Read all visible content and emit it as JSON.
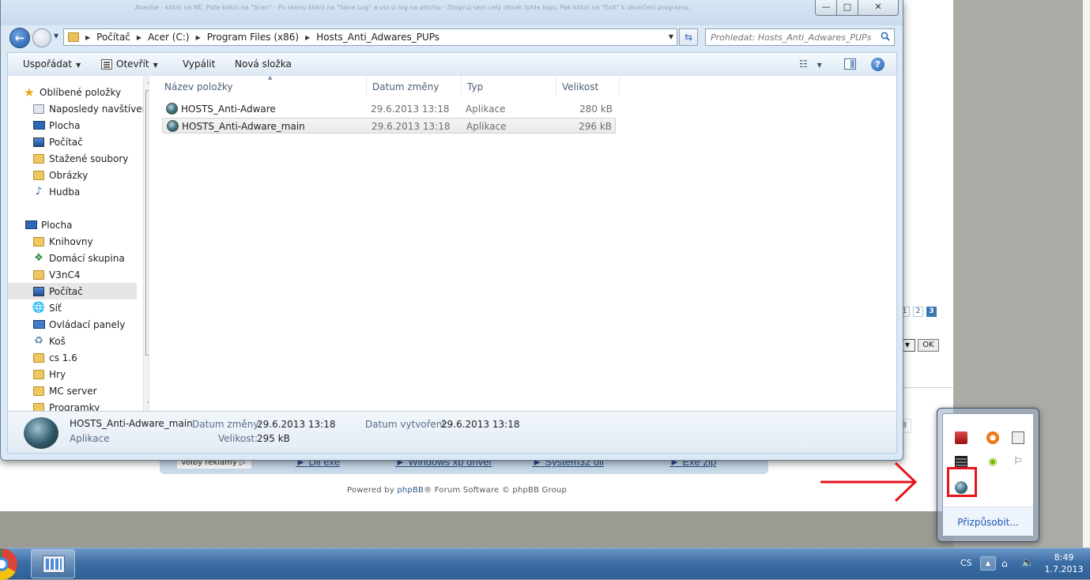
{
  "background_page": {
    "blurred_text": "Anastie - klikni na NE, Pote klikni na \"Scan\" - Po skenu klikni na \"Save Log\" a ulo si log na plochu - Zkopruj sem celý obsah tohle logu. Pak klikni na \"Exit\" k ukončení programu.",
    "pagination": [
      "1",
      "2",
      "3"
    ],
    "ok_button": "OK",
    "ad_label": "Volby reklamy",
    "ad_links": [
      "► Dll exe",
      "► Windows xp driver",
      "► System32 dll",
      "► Exe zip"
    ],
    "powered_by": {
      "prefix": "Powered by ",
      "brand": "phpBB",
      "suffix": "® Forum Software © phpBB Group"
    },
    "box_char": "3"
  },
  "window": {
    "buttons": {
      "minimize": "—",
      "maximize": "□",
      "close": "✕"
    },
    "breadcrumbs": [
      "Počítač",
      "Acer (C:)",
      "Program Files (x86)",
      "Hosts_Anti_Adwares_PUPs"
    ],
    "search_placeholder": "Prohledat: Hosts_Anti_Adwares_PUPs",
    "toolbar": {
      "organize": "Uspořádat",
      "open": "Otevřít",
      "burn": "Vypálit",
      "new_folder": "Nová složka",
      "help": "?"
    },
    "nav": {
      "favorites": "Oblíbené položky",
      "recent": "Naposledy navštívené",
      "desktop_fav": "Plocha",
      "computer_fav": "Počítač",
      "downloads": "Stažené soubory",
      "pictures": "Obrázky",
      "music": "Hudba",
      "desktop": "Plocha",
      "libraries": "Knihovny",
      "homegroup": "Domácí skupina",
      "v3nc4": "V3nC4",
      "computer": "Počítač",
      "network": "Síť",
      "control_panel": "Ovládací panely",
      "recycle_bin": "Koš",
      "cs16": "cs 1.6",
      "games": "Hry",
      "mc_server": "MC server",
      "programs": "Programky"
    },
    "columns": {
      "name": "Název položky",
      "date": "Datum změny",
      "type": "Typ",
      "size": "Velikost"
    },
    "files": [
      {
        "name": "HOSTS_Anti-Adware",
        "date": "29.6.2013 13:18",
        "type": "Aplikace",
        "size": "280 kB"
      },
      {
        "name": "HOSTS_Anti-Adware_main",
        "date": "29.6.2013 13:18",
        "type": "Aplikace",
        "size": "296 kB"
      }
    ],
    "details": {
      "name": "HOSTS_Anti-Adware_main",
      "kind": "Aplikace",
      "modified_label": "Datum změny:",
      "modified_value": "29.6.2013 13:18",
      "size_label": "Velikost:",
      "size_value": "295 kB",
      "created_label": "Datum vytvoření:",
      "created_value": "29.6.2013 13:18"
    }
  },
  "taskbar": {
    "language": "CS",
    "time": "8:49",
    "date": "1.7.2013"
  },
  "tray_popup": {
    "customize": "Přizpůsobit..."
  },
  "colors": {
    "highlight": "#e8141c",
    "link": "#1e5bb8"
  }
}
